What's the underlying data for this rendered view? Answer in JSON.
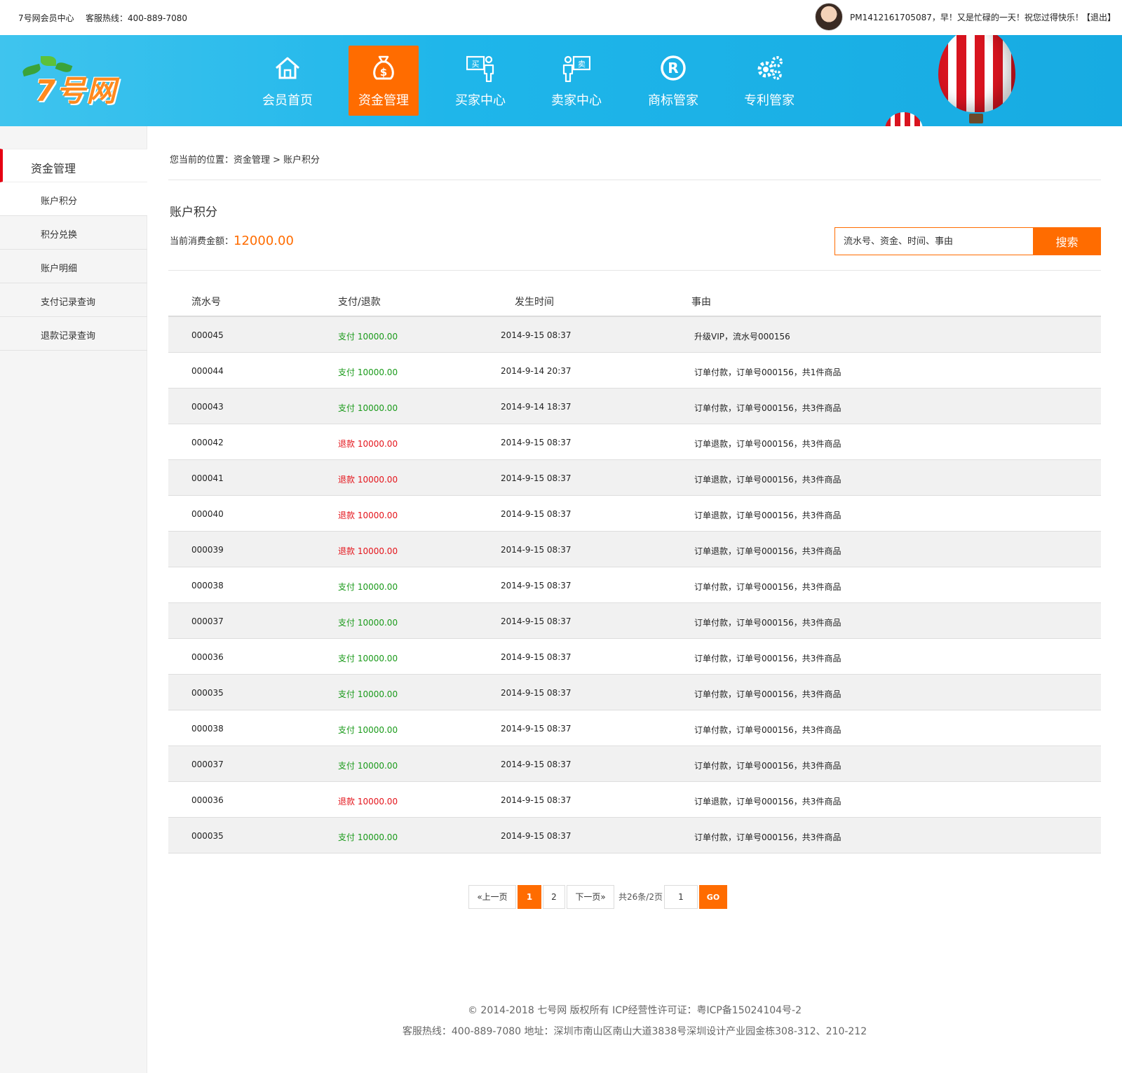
{
  "topbar": {
    "site": "7号网会员中心",
    "hotline": "客服热线：400-889-7080",
    "greeting": "PM1412161705087，早！又是忙碌的一天！祝您过得快乐！",
    "logout": "【退出】"
  },
  "logo": {
    "text": "7号网"
  },
  "nav": {
    "items": [
      {
        "label": "会员首页",
        "icon": "house-icon"
      },
      {
        "label": "资金管理",
        "icon": "money-bag-icon"
      },
      {
        "label": "买家中心",
        "icon": "buyer-icon"
      },
      {
        "label": "卖家中心",
        "icon": "seller-icon"
      },
      {
        "label": "商标管家",
        "icon": "registered-icon"
      },
      {
        "label": "专利管家",
        "icon": "gears-icon"
      }
    ],
    "active_index": 1
  },
  "sidebar": {
    "title": "资金管理",
    "items": [
      {
        "label": "账户积分"
      },
      {
        "label": "积分兑换"
      },
      {
        "label": "账户明细"
      },
      {
        "label": "支付记录查询"
      },
      {
        "label": "退款记录查询"
      }
    ],
    "active_index": 0
  },
  "breadcrumb": {
    "prefix": "您当前的位置：",
    "level1": "资金管理",
    "sep": ">",
    "level2": "账户积分"
  },
  "page": {
    "title": "账户积分",
    "balance_label": "当前消费金额：",
    "balance_value": "12000.00"
  },
  "search": {
    "placeholder": "流水号、资金、时间、事由",
    "button": "搜索"
  },
  "table": {
    "headers": [
      "流水号",
      "支付/退款",
      "发生时间",
      "事由"
    ],
    "rows": [
      {
        "id": "000045",
        "type": "pay",
        "amount": "支付 10000.00",
        "time": "2014-9-15  08:37",
        "reason": "升级VIP，流水号000156"
      },
      {
        "id": "000044",
        "type": "pay",
        "amount": "支付 10000.00",
        "time": "2014-9-14  20:37",
        "reason": "订单付款，订单号000156，共1件商品"
      },
      {
        "id": "000043",
        "type": "pay",
        "amount": "支付 10000.00",
        "time": "2014-9-14  18:37",
        "reason": "订单付款，订单号000156，共3件商品"
      },
      {
        "id": "000042",
        "type": "refund",
        "amount": "退款 10000.00",
        "time": "2014-9-15  08:37",
        "reason": "订单退款，订单号000156，共3件商品"
      },
      {
        "id": "000041",
        "type": "refund",
        "amount": "退款 10000.00",
        "time": "2014-9-15  08:37",
        "reason": "订单退款，订单号000156，共3件商品"
      },
      {
        "id": "000040",
        "type": "refund",
        "amount": "退款 10000.00",
        "time": "2014-9-15  08:37",
        "reason": "订单退款，订单号000156，共3件商品"
      },
      {
        "id": "000039",
        "type": "refund",
        "amount": "退款 10000.00",
        "time": "2014-9-15  08:37",
        "reason": "订单退款，订单号000156，共3件商品"
      },
      {
        "id": "000038",
        "type": "pay",
        "amount": "支付 10000.00",
        "time": "2014-9-15  08:37",
        "reason": "订单付款，订单号000156，共3件商品"
      },
      {
        "id": "000037",
        "type": "pay",
        "amount": "支付 10000.00",
        "time": "2014-9-15  08:37",
        "reason": "订单付款，订单号000156，共3件商品"
      },
      {
        "id": "000036",
        "type": "pay",
        "amount": "支付 10000.00",
        "time": "2014-9-15  08:37",
        "reason": "订单付款，订单号000156，共3件商品"
      },
      {
        "id": "000035",
        "type": "pay",
        "amount": "支付 10000.00",
        "time": "2014-9-15  08:37",
        "reason": "订单付款，订单号000156，共3件商品"
      },
      {
        "id": "000038",
        "type": "pay",
        "amount": "支付 10000.00",
        "time": "2014-9-15  08:37",
        "reason": "订单付款，订单号000156，共3件商品"
      },
      {
        "id": "000037",
        "type": "pay",
        "amount": "支付 10000.00",
        "time": "2014-9-15  08:37",
        "reason": "订单付款，订单号000156，共3件商品"
      },
      {
        "id": "000036",
        "type": "refund",
        "amount": "退款 10000.00",
        "time": "2014-9-15  08:37",
        "reason": "订单退款，订单号000156，共3件商品"
      },
      {
        "id": "000035",
        "type": "pay",
        "amount": "支付 10000.00",
        "time": "2014-9-15  08:37",
        "reason": "订单付款，订单号000156，共3件商品"
      }
    ]
  },
  "pagination": {
    "prev": "«上一页",
    "pages": [
      "1",
      "2"
    ],
    "current": "1",
    "next": "下一页»",
    "summary": "共26条/2页",
    "input_value": "1",
    "go": "GO"
  },
  "footer": {
    "line1": "© 2014-2018 七号网 版权所有 ICP经营性许可证：粤ICP备15024104号-2",
    "line2": "客服热线：400-889-7080   地址：深圳市南山区南山大道3838号深圳设计产业园金栋308-312、210-212"
  },
  "colors": {
    "accent": "#ff6c00",
    "header_blue": "#1fb6ea",
    "pay_green": "#1a9a1a",
    "refund_red": "#e4141b",
    "sidebar_marker": "#e60012"
  }
}
